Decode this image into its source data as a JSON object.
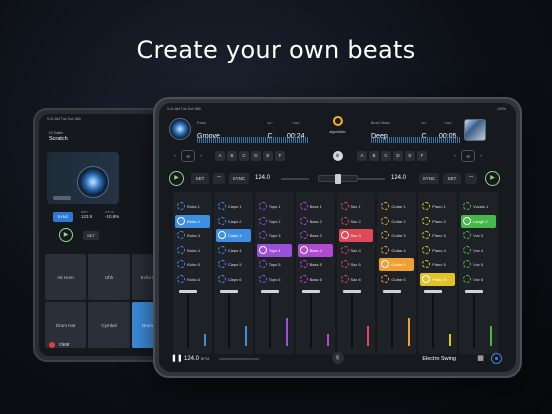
{
  "headline": "Create your own beats",
  "back_tablet": {
    "status": "9:41 AM  Tue Oct 18th",
    "artist": "DJ Battle",
    "title": "Scratch",
    "bpm_label": "BPM",
    "bpm": "123.5",
    "pitch_label": "PITCH",
    "pitch": "-10.8%",
    "sync": "SYNC",
    "set": "SET",
    "pads": [
      "Air Horn",
      "Uhh",
      "Echo Bleep",
      "Drum Hat",
      "Cymbal",
      "Drum Kick"
    ],
    "clear": "clear",
    "footer_bpm": "123"
  },
  "front_tablet": {
    "status_left": "9:41 AM  Tue Oct 18th",
    "status_right": "100%",
    "brand": "algoriddim",
    "deck_a": {
      "artist": "Fourk",
      "title": "Groove",
      "key_label": "KEY",
      "key": "C",
      "time_label": "TIME",
      "time": "00:24"
    },
    "deck_b": {
      "artist": "Bruce Maus",
      "title": "Deep",
      "key_label": "KEY",
      "key": "C",
      "time_label": "TIME",
      "time": "00:05"
    },
    "letters": [
      "A",
      "B",
      "C",
      "D",
      "E",
      "F"
    ],
    "set": "SET",
    "sync": "SYNC",
    "bpm_a": "124.0",
    "bpm_b": "124.0",
    "channels": [
      {
        "color": "#3d8fe2",
        "on": 1,
        "cells": [
          "Kicks 1",
          "Kicks 2",
          "Kicks 3",
          "Kicks 4",
          "Kicks 5",
          "Kicks 6"
        ]
      },
      {
        "color": "#3d8fe2",
        "on": 2,
        "cells": [
          "Claps 1",
          "Claps 2",
          "Claps 3",
          "Claps 4",
          "Claps 5",
          "Claps 6"
        ]
      },
      {
        "color": "#9b4fd8",
        "on": 3,
        "cells": [
          "Tops 1",
          "Tops 2",
          "Tops 3",
          "Tops 4",
          "Tops 5",
          "Tops 6"
        ]
      },
      {
        "color": "#b04ad0",
        "on": 3,
        "cells": [
          "Bass 1",
          "Bass 2",
          "Bass 3",
          "Bass 4",
          "Bass 5",
          "Bass 6"
        ]
      },
      {
        "color": "#e04a58",
        "on": 2,
        "cells": [
          "Sax 1",
          "Sax 2",
          "Sax 3",
          "Sax 4",
          "Sax 5",
          "Sax 6"
        ]
      },
      {
        "color": "#f0a030",
        "on": 4,
        "cells": [
          "Guitar 1",
          "Guitar 2",
          "Guitar 3",
          "Guitar 4",
          "Guitar 5",
          "Guitar 6"
        ]
      },
      {
        "color": "#e2c22a",
        "on": 5,
        "cells": [
          "Piano 1",
          "Piano 2",
          "Piano 3",
          "Piano 4",
          "Piano 5",
          "Piano 6"
        ]
      },
      {
        "color": "#47b84a",
        "on": 1,
        "cells": [
          "Vocals 1",
          "Laugh 2",
          "Vox 3",
          "Vox 4",
          "Vox 5",
          "Vox 6"
        ]
      }
    ],
    "footer": {
      "bpm": "124.0",
      "bpm_unit": "BPM",
      "genre": "Electro Swing"
    }
  }
}
